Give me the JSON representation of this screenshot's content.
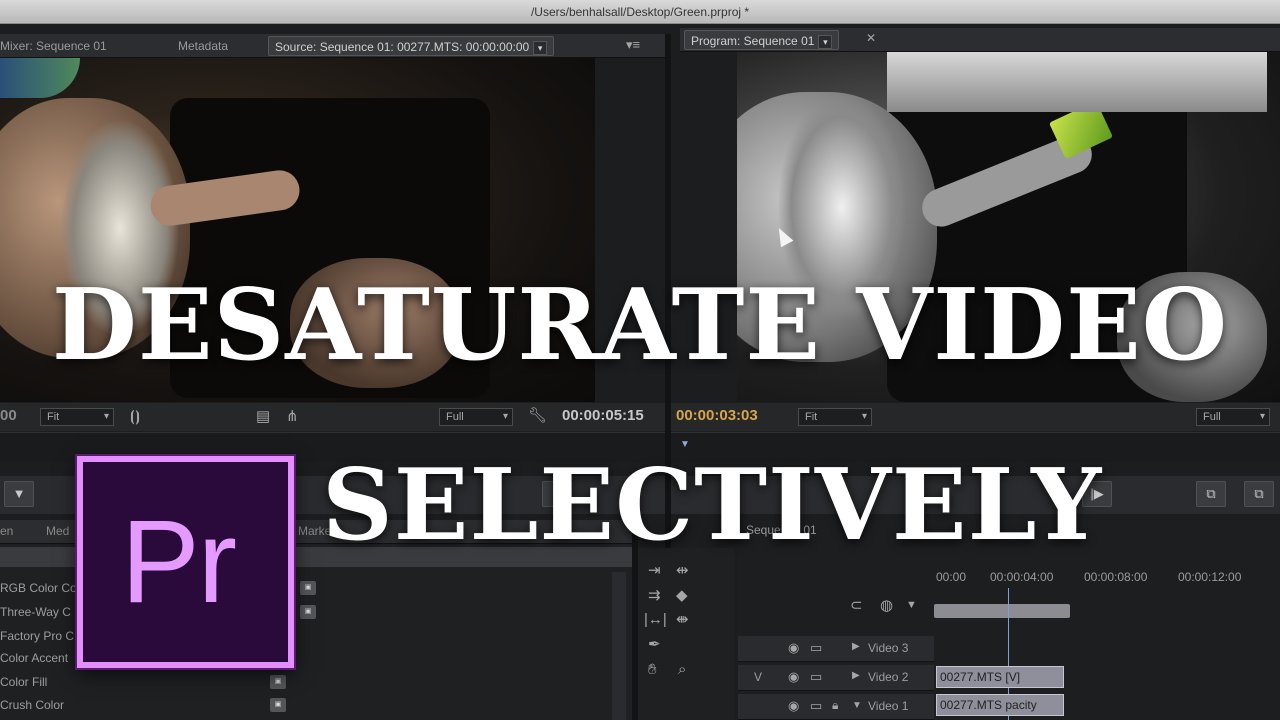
{
  "window": {
    "title": "/Users/benhalsall/Desktop/Green.prproj *"
  },
  "source_panel": {
    "tabs": [
      {
        "label": "Mixer: Sequence 01"
      },
      {
        "label": "Metadata"
      },
      {
        "label": "Source: Sequence 01: 00277.MTS: 00:00:00:00"
      }
    ],
    "timecode_left": "00",
    "zoom": "Fit",
    "resolution": "Full",
    "timecode": "00:00:05:15"
  },
  "program_panel": {
    "tab": "Program: Sequence 01",
    "timecode": "00:00:03:03",
    "zoom": "Fit",
    "resolution": "Full"
  },
  "effects_panel": {
    "tabs": [
      "en",
      "Med"
    ],
    "extra_tab": "Marke",
    "items": [
      {
        "label": "RGB Color Co"
      },
      {
        "label": "Three-Way C"
      },
      {
        "label": "Factory Pro C"
      },
      {
        "label": "Color Accent"
      },
      {
        "label": "Color Fill"
      },
      {
        "label": "Crush Color"
      }
    ]
  },
  "timeline_panel": {
    "tab": "Sequence 01",
    "ruler": [
      "00:00",
      "00:00:04:00",
      "00:00:08:00",
      "00:00:12:00"
    ],
    "tracks": [
      {
        "name": "Video 3",
        "label": ""
      },
      {
        "name": "Video 2",
        "label": "V"
      },
      {
        "name": "Video 1",
        "label": ""
      }
    ],
    "clips": [
      {
        "label": "00277.MTS [V]"
      },
      {
        "label": "00277.MTS pacity"
      }
    ]
  },
  "overlay": {
    "line1": "DESATURATE VIDEO",
    "line2": "SELECTIVELY",
    "logo_text": "Pr"
  },
  "colors": {
    "accent_timecode": "#d8a64a",
    "logo_border": "#e48dff",
    "logo_bg": "#2a0a3a"
  }
}
